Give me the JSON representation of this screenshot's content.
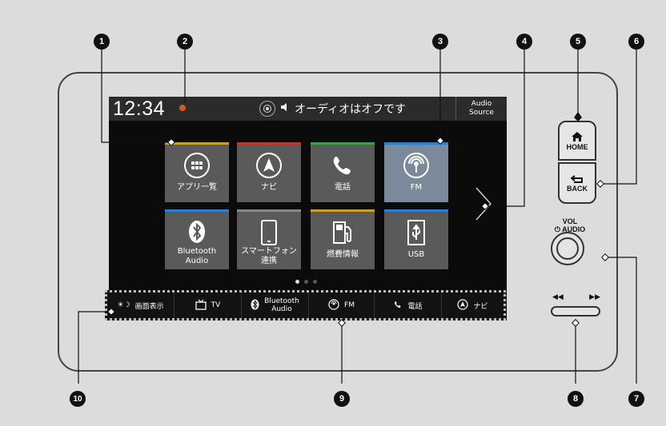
{
  "screen": {
    "clock": "12:34",
    "now_playing": "オーディオはオフです",
    "audio_source": "Audio\nSource",
    "tiles": [
      {
        "label": "アプリ一覧",
        "icon": "app-grid-icon",
        "color": "#c9a227"
      },
      {
        "label": "ナビ",
        "icon": "navigation-icon",
        "color": "#c0392b"
      },
      {
        "label": "電話",
        "icon": "phone-icon",
        "color": "#3aa14a"
      },
      {
        "label": "FM",
        "icon": "radio-icon",
        "color": "#2a7fd4"
      },
      {
        "label": "Bluetooth\nAudio",
        "icon": "bluetooth-icon",
        "color": "#2a7fd4"
      },
      {
        "label": "スマートフォン\n連携",
        "icon": "smartphone-icon",
        "color": "#888888"
      },
      {
        "label": "燃費情報",
        "icon": "fuel-info-icon",
        "color": "#d1a023"
      },
      {
        "label": "USB",
        "icon": "usb-icon",
        "color": "#2a7fd4"
      }
    ],
    "page_dots": {
      "count": 3,
      "active": 1
    }
  },
  "shortcut_bar": [
    {
      "label": "画面表示",
      "icon": "display-brightness-icon"
    },
    {
      "label": "TV",
      "icon": "tv-icon"
    },
    {
      "label": "Bluetooth\nAudio",
      "icon": "bluetooth-icon"
    },
    {
      "label": "FM",
      "icon": "radio-icon"
    },
    {
      "label": "電話",
      "icon": "phone-icon"
    },
    {
      "label": "ナビ",
      "icon": "navigation-icon"
    }
  ],
  "hard_buttons": {
    "home": "HOME",
    "back": "BACK",
    "vol_audio": "VOL\n⏻ AUDIO",
    "seek_prev": "◀◀",
    "seek_next": "▶▶"
  },
  "callouts": [
    "1",
    "2",
    "3",
    "4",
    "5",
    "6",
    "7",
    "8",
    "9",
    "10"
  ]
}
